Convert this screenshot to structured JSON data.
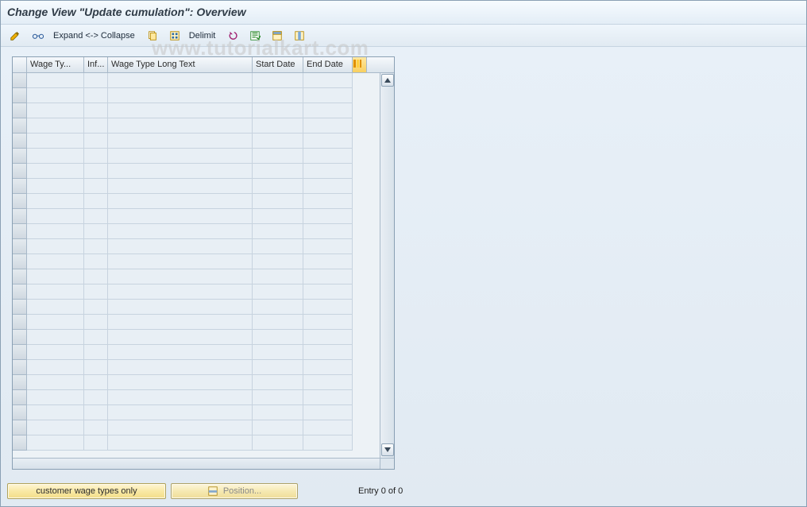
{
  "title": "Change View \"Update cumulation\": Overview",
  "toolbar": {
    "expand_collapse_label": "Expand <-> Collapse",
    "delimit_label": "Delimit"
  },
  "columns": {
    "wage_type": "Wage Ty...",
    "infotype": "Inf...",
    "wage_type_long": "Wage Type Long Text",
    "start_date": "Start Date",
    "end_date": "End Date"
  },
  "rows": [
    {
      "wage_type": "",
      "infotype": "",
      "long": "",
      "start": "",
      "end": ""
    },
    {
      "wage_type": "",
      "infotype": "",
      "long": "",
      "start": "",
      "end": ""
    },
    {
      "wage_type": "",
      "infotype": "",
      "long": "",
      "start": "",
      "end": ""
    },
    {
      "wage_type": "",
      "infotype": "",
      "long": "",
      "start": "",
      "end": ""
    },
    {
      "wage_type": "",
      "infotype": "",
      "long": "",
      "start": "",
      "end": ""
    },
    {
      "wage_type": "",
      "infotype": "",
      "long": "",
      "start": "",
      "end": ""
    },
    {
      "wage_type": "",
      "infotype": "",
      "long": "",
      "start": "",
      "end": ""
    },
    {
      "wage_type": "",
      "infotype": "",
      "long": "",
      "start": "",
      "end": ""
    },
    {
      "wage_type": "",
      "infotype": "",
      "long": "",
      "start": "",
      "end": ""
    },
    {
      "wage_type": "",
      "infotype": "",
      "long": "",
      "start": "",
      "end": ""
    },
    {
      "wage_type": "",
      "infotype": "",
      "long": "",
      "start": "",
      "end": ""
    },
    {
      "wage_type": "",
      "infotype": "",
      "long": "",
      "start": "",
      "end": ""
    },
    {
      "wage_type": "",
      "infotype": "",
      "long": "",
      "start": "",
      "end": ""
    },
    {
      "wage_type": "",
      "infotype": "",
      "long": "",
      "start": "",
      "end": ""
    },
    {
      "wage_type": "",
      "infotype": "",
      "long": "",
      "start": "",
      "end": ""
    },
    {
      "wage_type": "",
      "infotype": "",
      "long": "",
      "start": "",
      "end": ""
    },
    {
      "wage_type": "",
      "infotype": "",
      "long": "",
      "start": "",
      "end": ""
    },
    {
      "wage_type": "",
      "infotype": "",
      "long": "",
      "start": "",
      "end": ""
    },
    {
      "wage_type": "",
      "infotype": "",
      "long": "",
      "start": "",
      "end": ""
    },
    {
      "wage_type": "",
      "infotype": "",
      "long": "",
      "start": "",
      "end": ""
    },
    {
      "wage_type": "",
      "infotype": "",
      "long": "",
      "start": "",
      "end": ""
    },
    {
      "wage_type": "",
      "infotype": "",
      "long": "",
      "start": "",
      "end": ""
    },
    {
      "wage_type": "",
      "infotype": "",
      "long": "",
      "start": "",
      "end": ""
    },
    {
      "wage_type": "",
      "infotype": "",
      "long": "",
      "start": "",
      "end": ""
    },
    {
      "wage_type": "",
      "infotype": "",
      "long": "",
      "start": "",
      "end": ""
    }
  ],
  "footer": {
    "customer_wt_label": "customer wage types only",
    "position_label": "Position...",
    "entry_status": "Entry 0 of 0"
  },
  "watermark": "www.tutorialkart.com"
}
